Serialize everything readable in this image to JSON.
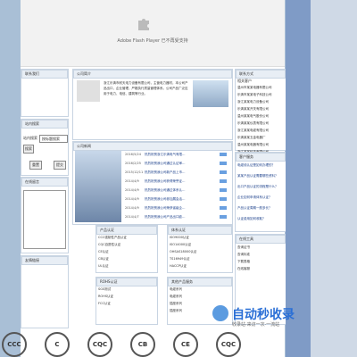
{
  "flash": {
    "message": "Adobe Flash Player 已不再受支持"
  },
  "left": {
    "contact_header": "联系我们",
    "search_header": "站内搜索",
    "search_label": "站内搜索",
    "search_select": "按标题搜索",
    "search_btn": "搜索",
    "reset_btn": "重置",
    "submit_btn": "提交",
    "msg_header": "在线留言",
    "link_header": "友情链接"
  },
  "company": {
    "header": "公司简介",
    "intro": "浙江乐清市耐天电力设备有限公司，主营电力器材，本公司产品出口，企业管理，严格执行质量管理体系。公司产品广泛应用于电力、电信、建筑等行业。"
  },
  "news": {
    "header": "公司新闻",
    "items": [
      {
        "date": "2016/5/24",
        "title": "热烈祝贺浙江乐清电气有限…"
      },
      {
        "date": "2016/2/25",
        "title": "热烈祝贺我公司通过认证审…"
      },
      {
        "date": "2015/12/11",
        "title": "热烈祝贺我公司新产品上市…"
      },
      {
        "date": "2014/4/9",
        "title": "热烈祝贺我公司获得荣誉证…"
      },
      {
        "date": "2014/4/9",
        "title": "热烈祝贺我公司通过体系认…"
      },
      {
        "date": "2014/4/9",
        "title": "热烈祝贺我公司参加展会活…"
      },
      {
        "date": "2014/4/9",
        "title": "热烈祝贺我公司荣获省级企…"
      },
      {
        "date": "2014/4/7",
        "title": "热烈祝贺我公司产品出口欧…"
      }
    ]
  },
  "certs": {
    "header_left": "产品认证",
    "header_right": "体系认证",
    "left_items": [
      "CCC强制性产品认证",
      "CQC自愿性认证",
      "CE认证",
      "CB认证",
      "UL认证"
    ],
    "right_items": [
      "ISO9000认证",
      "ISO14000认证",
      "OHSAS18000认证",
      "TS16949认证",
      "HACCP认证"
    ]
  },
  "lists": {
    "header_left": "ROHS认证",
    "header_right": "其他产品服务",
    "left_items": [
      "SGS测试",
      "ROHS认证",
      "FCC认证"
    ],
    "right_items": [
      "电缆系列",
      "电缆系列",
      "插座系列",
      "插座系列"
    ]
  },
  "right": {
    "header1": "联系方式",
    "sub1": "相关客户",
    "companies": [
      "温州市某某电器有限公司",
      "乐清市某某电子科技公司",
      "浙江某某电力设备公司",
      "乐清某某开关有限公司",
      "温州某某电气股份公司",
      "乐清某某仪表有限公司",
      "浙江某某电缆有限公司",
      "乐清某某五金电器厂",
      "温州某某电器有限公司",
      "浙江某某科技有限公司"
    ],
    "header2": "客户服务",
    "faq": [
      "电缆线认证是如何办理的？",
      "某某产品认证需要哪些资料？",
      "出口产品认证的流程是什么？",
      "企业如何申请体系认证？",
      "产品认证周期一般多长？",
      "认证费用如何收取？"
    ],
    "header3": "在线工具",
    "tools": [
      "查询证书",
      "查询标准",
      "下载表格",
      "在线客服"
    ]
  },
  "watermark": {
    "logo_text": "自动秒收录",
    "slogan": "收录站·来访一次·一流站"
  },
  "logos": [
    "CCC",
    "C",
    "CQC",
    "CB",
    "CE",
    "CQC"
  ]
}
